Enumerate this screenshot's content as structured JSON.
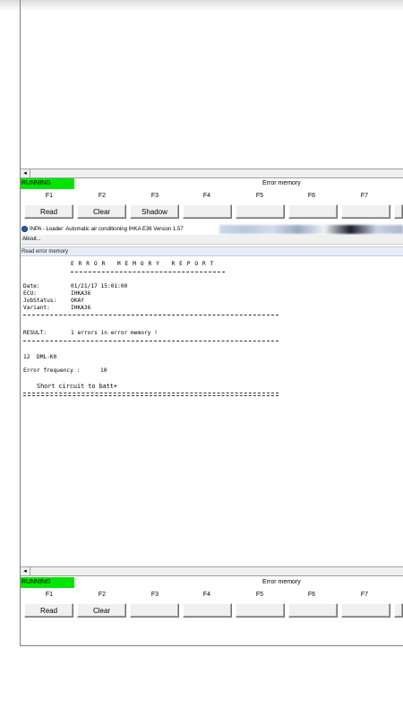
{
  "scroll_arrow": "◂",
  "top_panel": {
    "status": "RUNNING",
    "title": "Error memory",
    "fkeys": [
      "F1",
      "F2",
      "F3",
      "F4",
      "F5",
      "F6",
      "F7"
    ],
    "buttons": [
      "Read",
      "Clear",
      "Shadow",
      "",
      "",
      "",
      "",
      ""
    ]
  },
  "window": {
    "title": "INPA - Loader: Automatic air conditioning IHKA E36 Version 1.57",
    "menu": "About...",
    "subtitle": "Read error memory"
  },
  "report": {
    "header": "E R R O R   M E M O R Y   R E P O R T",
    "date_label": "Date:",
    "date_value": "01/21/17 15:01:00",
    "ecu_label": "ECU:",
    "ecu_value": "IHKA36",
    "jobstatus_label": "JobStatus:",
    "jobstatus_value": "OKAY",
    "variant_label": "Variant:",
    "variant_value": "IHKA36",
    "result_label": "RESULT:",
    "result_value": "1 errors in error memory !",
    "error_code": "12",
    "error_name": "DML-K0",
    "freq_label": "Error frequency :",
    "freq_value": "10",
    "description": "Short circuit to batt+"
  },
  "bottom_panel": {
    "status": "RUNNING",
    "title": "Error memory",
    "fkeys": [
      "F1",
      "F2",
      "F3",
      "F4",
      "F5",
      "F6",
      "F7"
    ],
    "buttons": [
      "Read",
      "Clear",
      "",
      "",
      "",
      "",
      "",
      ""
    ]
  }
}
